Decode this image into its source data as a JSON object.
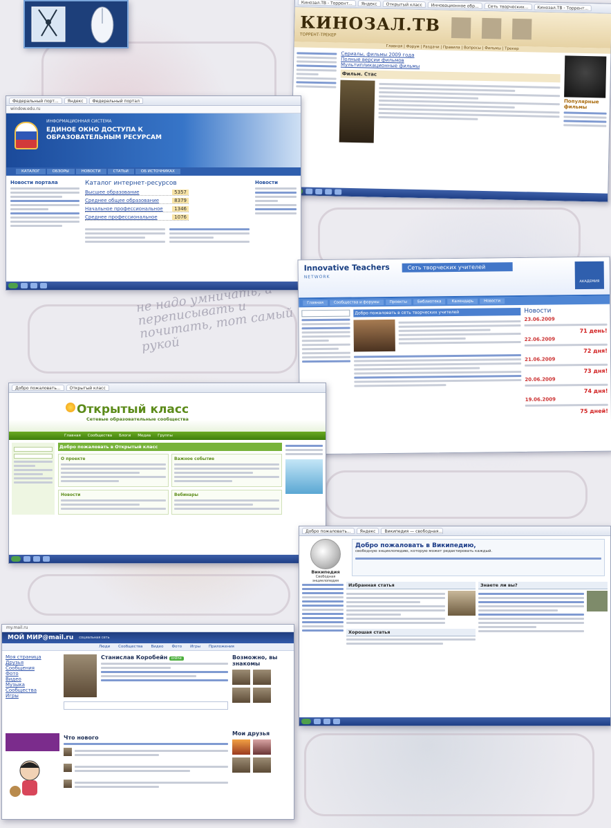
{
  "collage": {
    "scribble": "не надо умничать, а переписывать и почитать, тот самый рукой"
  },
  "kinozal": {
    "tabs": [
      "Кинозал.ТВ - Торрент...",
      "Яндекс",
      "Открытый класс",
      "Инновационное обр...",
      "Сеть творческих...",
      "Кинозал.ТВ - Торрент..."
    ],
    "logo": "КИНОЗАЛ.ТВ",
    "sub": "ТОРРЕНТ-ТРЕКЕР",
    "nav": "Главная | Форум | Раздачи | Правила | Вопросы | Фильмы | Трекер",
    "rows": [
      "Сериалы, фильмы 2009 года",
      "Полные версии фильмов",
      "Мультипликационные фильмы"
    ],
    "film_title": "Фильм. Стас",
    "right_heading": "Популярные фильмы"
  },
  "portal": {
    "tabs": [
      "Федеральный порт...",
      "Яндекс",
      "Федеральный портал"
    ],
    "address": "window.edu.ru",
    "banner_top": "ИНФОРМАЦИОННАЯ СИСТЕМА",
    "banner_title": "ЕДИНОЕ ОКНО ДОСТУПА К ОБРАЗОВАТЕЛЬНЫМ РЕСУРСАМ",
    "nav": [
      "КАТАЛОГ",
      "ОБЗОРЫ",
      "НОВОСТИ",
      "СТАТЬИ",
      "ОБ ИСТОЧНИКАХ"
    ],
    "catalog_title": "Каталог интернет-ресурсов",
    "catalog_rows": [
      {
        "label": "Высшее образование",
        "count": "5357"
      },
      {
        "label": "Среднее общее образование",
        "count": "8379"
      },
      {
        "label": "Начальное профессиональное",
        "count": "1346"
      },
      {
        "label": "Среднее профессиональное",
        "count": "1076"
      }
    ],
    "side_heading": "Новости",
    "left_heading": "Новости портала"
  },
  "teachers": {
    "brand": "Innovative Teachers",
    "brand_sub": "NETWORK",
    "title": "Сеть творческих учителей",
    "nav": [
      "Главная",
      "Сообщества и форумы",
      "Проекты",
      "Библиотека",
      "Календарь",
      "Новости"
    ],
    "welcome": "Добро пожаловать в сеть творческих учителей",
    "news_heading": "Новости",
    "news": [
      {
        "date": "23.06.2009",
        "deadline": "71 день!"
      },
      {
        "date": "22.06.2009",
        "deadline": "72 дня!"
      },
      {
        "date": "21.06.2009",
        "deadline": "73 дня!"
      },
      {
        "date": "20.06.2009",
        "deadline": "74 дня!"
      },
      {
        "date": "19.06.2009",
        "deadline": "75 дней!"
      }
    ],
    "academy": "АКАДЕМИЯ"
  },
  "openclass": {
    "tabs": [
      "Добро пожаловать...",
      "Открытый класс"
    ],
    "title": "Открытый класс",
    "subtitle": "Сетевые образовательные сообщества",
    "nav": [
      "Главная",
      "Сообщества",
      "Блоги",
      "Медиа",
      "Группы"
    ],
    "welcome": "Добро пожаловать в Открытый класс",
    "box1": "О проекте",
    "box2": "Важное событие",
    "box3": "Новости",
    "box4": "Вебинары"
  },
  "wiki": {
    "tabs": [
      "Добро пожаловать...",
      "Яндекс",
      "Википедия — свободная..."
    ],
    "site_name": "Википедия",
    "site_sub": "Свободная энциклопедия",
    "welcome": "Добро пожаловать в Википедию,",
    "welcome_sub": "свободную энциклопедию, которую может редактировать каждый.",
    "featured": "Избранная статья",
    "did_you_know": "Знаете ли вы?",
    "good": "Хорошая статья"
  },
  "mymail": {
    "address": "my.mail.ru",
    "logo": "МОЙ МИР@mail.ru",
    "logo_sub": "социальная сеть",
    "menu": [
      "Люди",
      "Сообщества",
      "Видео",
      "Фото",
      "Игры",
      "Приложения"
    ],
    "name": "Станислав Коробейн",
    "badge": "online",
    "maybe_know": "Возможно, вы знакомы",
    "whats_new": "Что нового",
    "friends": "Мои друзья",
    "left_items": [
      "Моя страница",
      "Друзья",
      "Сообщения",
      "Фото",
      "Видео",
      "Музыка",
      "Сообщества",
      "Игры"
    ]
  }
}
